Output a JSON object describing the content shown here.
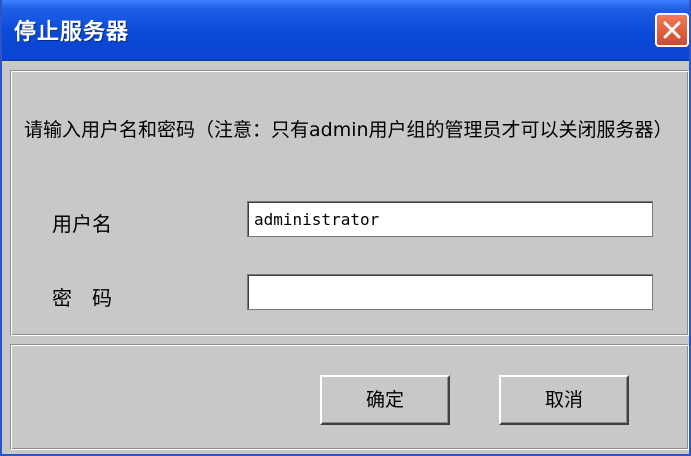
{
  "window": {
    "title": "停止服务器"
  },
  "dialog": {
    "instruction": "请输入用户名和密码（注意：只有admin用户组的管理员才可以关闭服务器）",
    "username_label": "用户名",
    "username_value": "administrator",
    "password_label": "密　码",
    "password_value": ""
  },
  "buttons": {
    "ok_label": "确定",
    "cancel_label": "取消"
  },
  "colors": {
    "titlebar": "#0b49d8",
    "close_button": "#d34a2a",
    "background": "#c8c8c8"
  }
}
